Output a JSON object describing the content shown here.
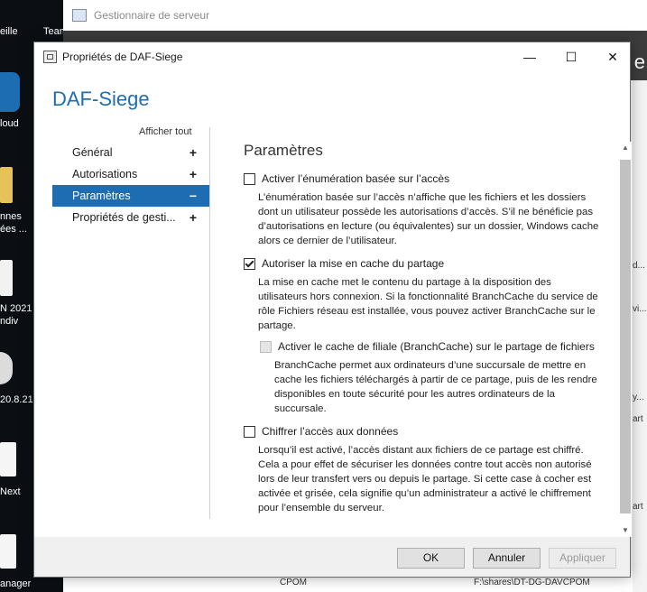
{
  "desktop": {
    "items": [
      "eille",
      "Team",
      "loud",
      "nnes",
      "ées ...",
      "N 2021",
      "ndiv",
      "20.8.21.",
      "Next",
      "anager"
    ]
  },
  "server_manager": {
    "title": "Gestionnaire de serveur",
    "corner_letter": "e",
    "right_snippets": [
      "d...",
      "vi...",
      "y...",
      "art",
      "art",
      "art"
    ],
    "bottom_left": "CPOM",
    "bottom_right": "F:\\shares\\DT-DG-DAVCPOM"
  },
  "dialog": {
    "title": "Propriétés de DAF-Siege",
    "minimize": "—",
    "maximize": "☐",
    "close": "✕",
    "heading": "DAF-Siege",
    "show_all": "Afficher tout",
    "nav": [
      {
        "label": "Général",
        "sign": "+"
      },
      {
        "label": "Autorisations",
        "sign": "+"
      },
      {
        "label": "Paramètres",
        "sign": "−"
      },
      {
        "label": "Propriétés de gesti...",
        "sign": "+"
      }
    ],
    "section_title": "Paramètres",
    "options": {
      "enum": {
        "label": "Activer l’énumération basée sur l’accès",
        "checked": false,
        "desc": "L’énumération basée sur l’accès n’affiche que les fichiers et les dossiers dont un utilisateur possède les autorisations d’accès. S’il ne bénéficie pas d’autorisations en lecture (ou équivalentes) sur un dossier, Windows cache alors ce dernier de l’utilisateur."
      },
      "cache": {
        "label": "Autoriser la mise en cache du partage",
        "checked": true,
        "desc": "La mise en cache met le contenu du partage à la disposition des utilisateurs hors connexion. Si la fonctionnalité BranchCache du service de rôle Fichiers réseau est installée, vous pouvez activer BranchCache sur le partage."
      },
      "branch": {
        "label": "Activer le cache de filiale (BranchCache) sur le partage de fichiers",
        "checked": false,
        "disabled": true,
        "desc": "BranchCache permet aux ordinateurs d’une succursale de mettre en cache les fichiers téléchargés à partir de ce partage, puis de les rendre disponibles en toute sécurité pour les autres ordinateurs de la succursale."
      },
      "encrypt": {
        "label": "Chiffrer l’accès aux données",
        "checked": false,
        "desc": "Lorsqu’il est activé, l’accès distant aux fichiers de ce partage est chiffré. Cela a pour effet de sécuriser les données contre tout accès non autorisé lors de leur transfert vers ou depuis le partage. Si cette case à cocher est activée et grisée, cela signifie qu’un administrateur a activé le chiffrement pour l’ensemble du serveur."
      }
    },
    "buttons": {
      "ok": "OK",
      "cancel": "Annuler",
      "apply": "Appliquer"
    }
  },
  "colors": {
    "accent": "#1e6db3",
    "heading": "#1f6fb0"
  }
}
